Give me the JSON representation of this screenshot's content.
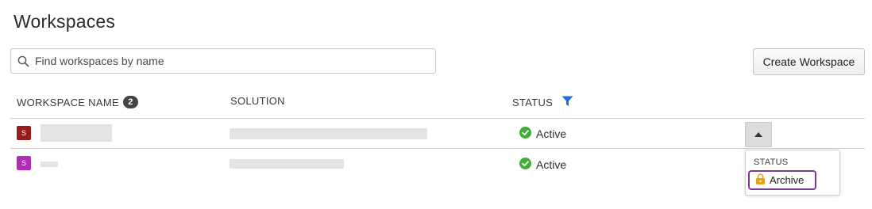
{
  "page": {
    "title": "Workspaces"
  },
  "search": {
    "placeholder": "Find workspaces by name",
    "value": ""
  },
  "toolbar": {
    "create_label": "Create Workspace"
  },
  "table": {
    "columns": {
      "workspace_name": "WORKSPACE NAME",
      "workspace_count": "2",
      "solution": "SOLUTION",
      "status": "STATUS"
    },
    "rows": [
      {
        "icon_letter": "S",
        "icon_color": "#9b1c1c",
        "status": "Active",
        "name_redacted": true,
        "solution_redacted": true
      },
      {
        "icon_letter": "S",
        "icon_color": "#b12bb5",
        "status": "Active",
        "name_redacted": true,
        "solution_redacted": true
      }
    ]
  },
  "status_dropdown": {
    "header": "STATUS",
    "items": [
      {
        "label": "Archive",
        "icon": "lock-icon"
      }
    ]
  },
  "colors": {
    "accent_blue": "#1f6fd6",
    "active_green": "#3cb034",
    "highlight_purple": "#7b3c97",
    "lock_orange": "#e8a317"
  },
  "icons": {
    "search": "search-icon",
    "filter": "filter-icon",
    "status_ok": "check-circle-icon",
    "expand": "caret-up-icon"
  }
}
